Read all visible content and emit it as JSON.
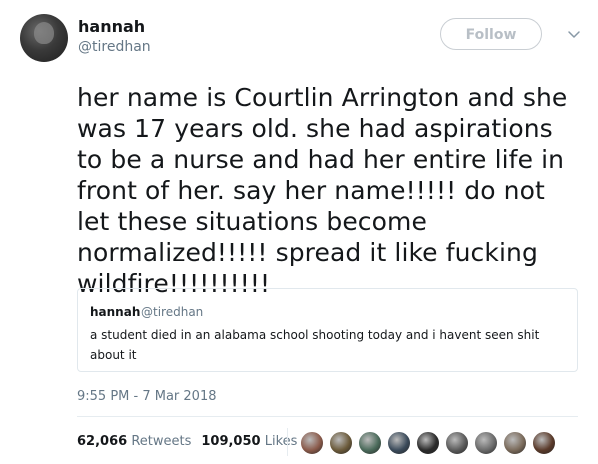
{
  "author": {
    "name": "hannah",
    "handle": "@tiredhan"
  },
  "follow_button": {
    "label": "Follow"
  },
  "tweet": {
    "text": "her name is Courtlin Arrington and she was 17 years old. she had aspirations to be a nurse and had her entire life in front of her. say her name!!!!! do not let these situations become normalized!!!!! spread it like fucking wildfire!!!!!!!!!!"
  },
  "quoted_tweet": {
    "name": "hannah",
    "handle": "@tiredhan",
    "text": "a student died in an alabama school shooting today and i havent seen shit about it"
  },
  "timestamp": "9:55 PM - 7 Mar 2018",
  "stats": {
    "retweets_count": "62,066",
    "retweets_label": "Retweets",
    "likes_count": "109,050",
    "likes_label": "Likes"
  },
  "liker_avatars": [
    {
      "name": "liker-avatar-1",
      "color": "#8a5a4a"
    },
    {
      "name": "liker-avatar-2",
      "color": "#6b5a3a"
    },
    {
      "name": "liker-avatar-3",
      "color": "#4a6a5a"
    },
    {
      "name": "liker-avatar-4",
      "color": "#3a4a5a"
    },
    {
      "name": "liker-avatar-5",
      "color": "#2a2a2a"
    },
    {
      "name": "liker-avatar-6",
      "color": "#5a5a5a"
    },
    {
      "name": "liker-avatar-7",
      "color": "#6a6a6a"
    },
    {
      "name": "liker-avatar-8",
      "color": "#7a6a5a"
    },
    {
      "name": "liker-avatar-9",
      "color": "#5a3a2a"
    }
  ],
  "colors": {
    "text_primary": "#14171a",
    "text_secondary": "#657786",
    "border": "#e1e8ed"
  }
}
